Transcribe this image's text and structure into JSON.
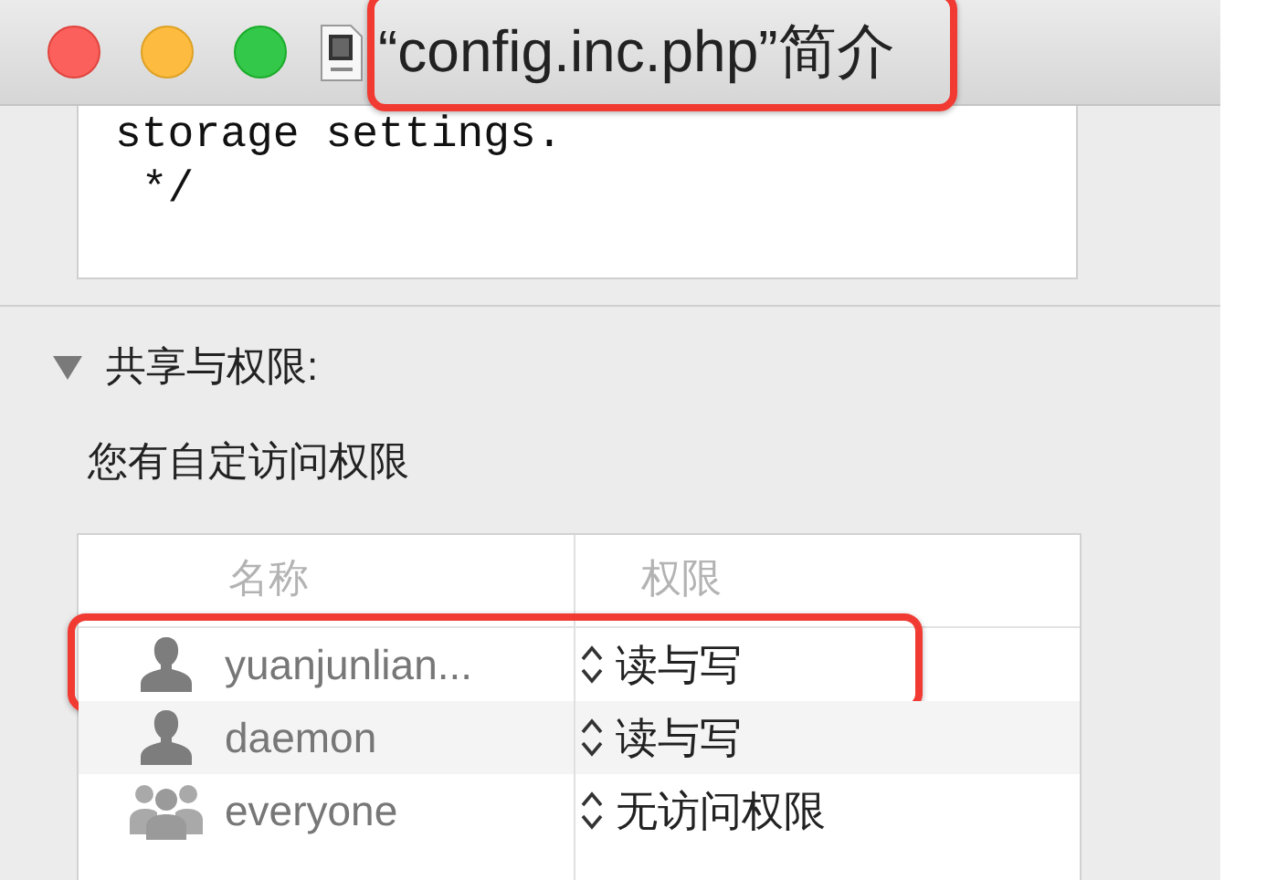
{
  "window": {
    "title": "“config.inc.php”简介",
    "title_highlighted": true
  },
  "preview": {
    "lines": [
      "storage settings.",
      " */"
    ]
  },
  "sharing": {
    "heading": "共享与权限:",
    "expanded": true,
    "summary": "您有自定访问权限",
    "columns": [
      "名称",
      "权限"
    ],
    "rows": [
      {
        "kind": "user",
        "name": "yuanjunlian...",
        "privilege": "读与写",
        "highlighted": true
      },
      {
        "kind": "user",
        "name": "daemon",
        "privilege": "读与写",
        "highlighted": false
      },
      {
        "kind": "group",
        "name": "everyone",
        "privilege": "无访问权限",
        "highlighted": false
      }
    ]
  }
}
